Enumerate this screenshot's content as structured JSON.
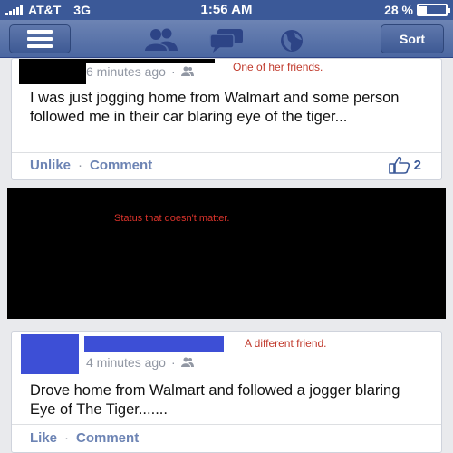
{
  "status_bar": {
    "carrier": "AT&T",
    "network": "3G",
    "time": "1:56 AM",
    "battery_percent": "28 %",
    "battery_level": 0.28
  },
  "nav": {
    "sort_label": "Sort",
    "icons": [
      "menu-icon",
      "friends-icon",
      "messages-icon",
      "globe-icon"
    ]
  },
  "post1": {
    "time_ago": "6 minutes ago",
    "annotation": "One of her friends.",
    "text": "I was just jogging home from Walmart and some person followed me in their car blaring eye of the tiger...",
    "actions": {
      "unlike": "Unlike",
      "sep": "·",
      "comment": "Comment"
    },
    "like_count": "2"
  },
  "middle_panel": {
    "annotation": "Status that doesn't matter."
  },
  "post2": {
    "time_ago": "4 minutes ago",
    "annotation": "A different friend.",
    "text": "Drove home from Walmart and followed a jogger blaring Eye of The Tiger.......",
    "actions": {
      "like": "Like",
      "sep": "·",
      "comment": "Comment"
    }
  },
  "colors": {
    "brand_blue": "#3b5998",
    "annotation_red": "#c0392b",
    "redaction_blue": "#3d4fd6"
  }
}
